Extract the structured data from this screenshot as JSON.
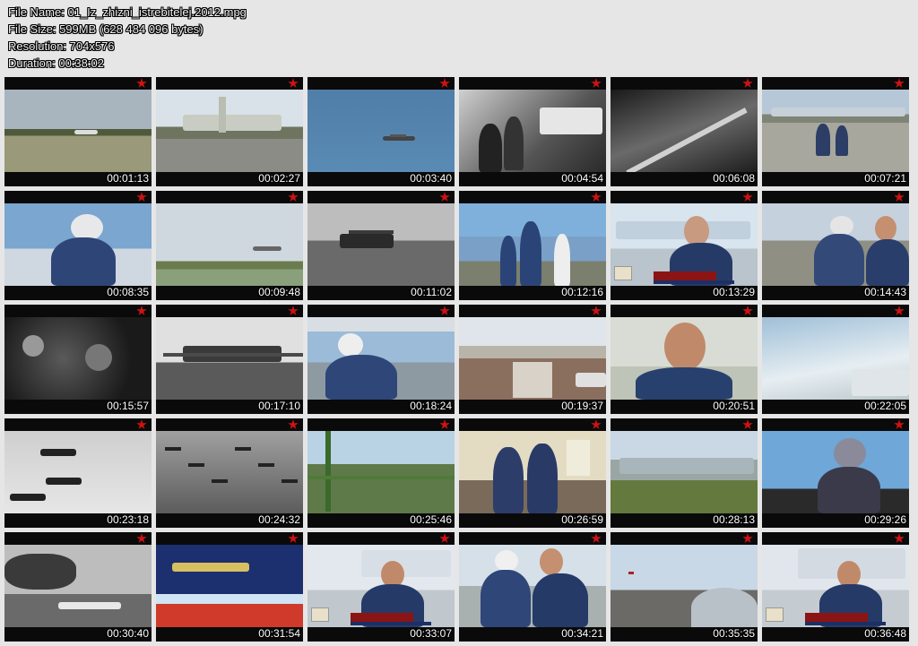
{
  "info": {
    "file_name": "File Name: 01_Iz_zhizni_istrebitelej.2012.mpg",
    "file_size": "File Size: 599MB (628 484 096 bytes)",
    "resolution": "Resolution: 704x576",
    "duration": "Duration: 00:38:02"
  },
  "thumbnails": [
    {
      "time": "00:01:13",
      "scene": "runway-takeoff"
    },
    {
      "time": "00:02:27",
      "scene": "jet-front-taxi"
    },
    {
      "time": "00:03:40",
      "scene": "jet-in-blue-sky"
    },
    {
      "time": "00:04:54",
      "scene": "bw-mechanics-at-plane"
    },
    {
      "time": "00:06:08",
      "scene": "bw-aerial-runway"
    },
    {
      "time": "00:07:21",
      "scene": "pilots-on-airfield"
    },
    {
      "time": "00:08:35",
      "scene": "pilot-helmet-cockpit"
    },
    {
      "time": "00:09:48",
      "scene": "jet-over-horizon"
    },
    {
      "time": "00:11:02",
      "scene": "bw-biplane-field"
    },
    {
      "time": "00:12:16",
      "scene": "crew-by-jet"
    },
    {
      "time": "00:13:29",
      "scene": "interview-man-jet"
    },
    {
      "time": "00:14:43",
      "scene": "pilots-under-wing"
    },
    {
      "time": "00:15:57",
      "scene": "bw-cockpit-gauges"
    },
    {
      "time": "00:17:10",
      "scene": "bw-fighter-landing"
    },
    {
      "time": "00:18:24",
      "scene": "pilot-climbing"
    },
    {
      "time": "00:19:37",
      "scene": "runway-from-cockpit"
    },
    {
      "time": "00:20:51",
      "scene": "interview-closeup"
    },
    {
      "time": "00:22:05",
      "scene": "cockpit-sky-clouds"
    },
    {
      "time": "00:23:18",
      "scene": "bw-jets-formation"
    },
    {
      "time": "00:24:32",
      "scene": "bw-airfield-planes"
    },
    {
      "time": "00:25:46",
      "scene": "ladder-fence-field"
    },
    {
      "time": "00:26:59",
      "scene": "pilots-in-room"
    },
    {
      "time": "00:28:13",
      "scene": "jets-on-grass"
    },
    {
      "time": "00:29:26",
      "scene": "pilot-in-cockpit"
    },
    {
      "time": "00:30:40",
      "scene": "bw-jet-nose-mig"
    },
    {
      "time": "00:31:54",
      "scene": "jet-over-red-sea"
    },
    {
      "time": "00:33:07",
      "scene": "interview-man-jet-2"
    },
    {
      "time": "00:34:21",
      "scene": "pilots-with-papers"
    },
    {
      "time": "00:35:35",
      "scene": "cockpit-view-planes"
    },
    {
      "time": "00:36:48",
      "scene": "interview-man-jet-3"
    }
  ]
}
